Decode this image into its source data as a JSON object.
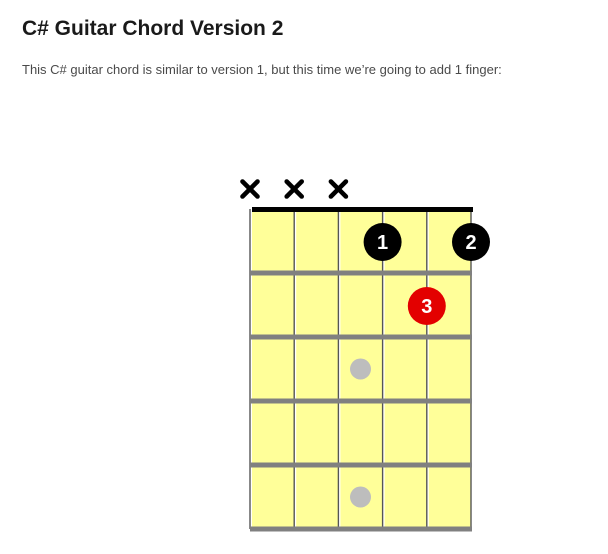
{
  "page": {
    "title": "C# Guitar Chord Version 2",
    "intro": "This C# guitar chord is similar to version 1, but this time we’re going to add 1 finger:"
  },
  "chord_diagram": {
    "strings": 6,
    "frets_shown": 5,
    "muted_strings": [
      1,
      2,
      3
    ],
    "muted_symbol": "✖",
    "fingers": [
      {
        "string": 4,
        "fret": 1,
        "label": "1",
        "color": "#000000"
      },
      {
        "string": 6,
        "fret": 1,
        "label": "2",
        "color": "#000000"
      },
      {
        "string": 5,
        "fret": 2,
        "label": "3",
        "color": "#e30000"
      }
    ],
    "inlays": [
      {
        "between_strings": [
          3,
          4
        ],
        "fret": 3
      },
      {
        "between_strings": [
          3,
          4
        ],
        "fret": 5
      }
    ],
    "colors": {
      "fretboard": "#ffff99",
      "nut": "#000000",
      "fret_wire": "#808080",
      "string": "#555555",
      "inlay": "#bdbdbd",
      "mute": "#000000"
    }
  }
}
